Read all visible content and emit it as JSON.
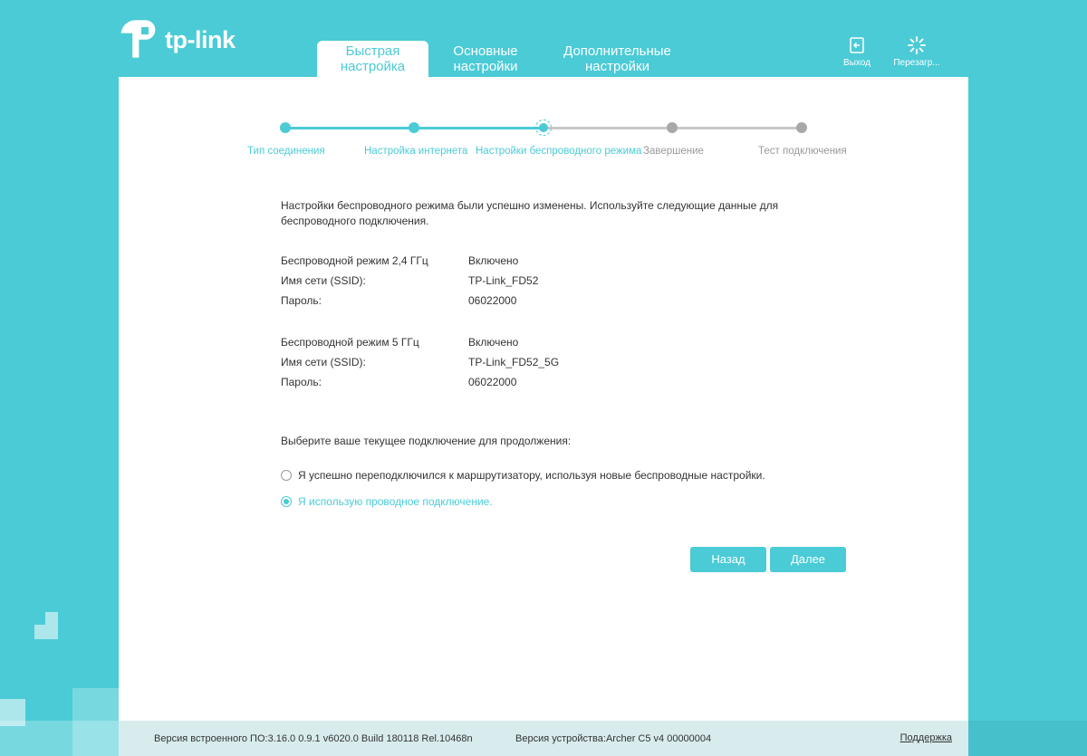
{
  "brand": {
    "name": "tp-link"
  },
  "tabs": [
    {
      "label": "Быстрая настройка",
      "active": true
    },
    {
      "label": "Основные настройки",
      "active": false
    },
    {
      "label": "Дополнительные настройки",
      "active": false
    }
  ],
  "actions": {
    "logout": "Выход",
    "reboot": "Перезагр..."
  },
  "steps": [
    {
      "label": "Тип соединения",
      "state": "done"
    },
    {
      "label": "Настройка интернета",
      "state": "done"
    },
    {
      "label": "Настройки беспроводного режима",
      "state": "current"
    },
    {
      "label": "Завершение",
      "state": "todo"
    },
    {
      "label": "Тест подключения",
      "state": "todo"
    }
  ],
  "content": {
    "intro": "Настройки беспроводного режима были успешно изменены. Используйте следующие данные для беспроводного подключения.",
    "band24": {
      "mode_label": "Беспроводной режим 2,4 ГГц",
      "mode_value": "Включено",
      "ssid_label": "Имя сети (SSID):",
      "ssid_value": "TP-Link_FD52",
      "pass_label": "Пароль:",
      "pass_value": "06022000"
    },
    "band5": {
      "mode_label": "Беспроводной режим 5 ГГц",
      "mode_value": "Включено",
      "ssid_label": "Имя сети (SSID):",
      "ssid_value": "TP-Link_FD52_5G",
      "pass_label": "Пароль:",
      "pass_value": "06022000"
    },
    "prompt": "Выберите ваше текущее подключение для продолжения:",
    "options": [
      {
        "label": "Я успешно переподключился к маршрутизатору, используя новые беспроводные настройки.",
        "checked": false
      },
      {
        "label": "Я использую проводное подключение.",
        "checked": true
      }
    ],
    "back": "Назад",
    "next": "Далее"
  },
  "footer": {
    "firmware": "Версия встроенного ПО:3.16.0 0.9.1 v6020.0 Build 180118 Rel.10468n",
    "hardware": "Версия устройства:Archer C5 v4 00000004",
    "support": "Поддержка"
  },
  "colors": {
    "accent": "#4acbd6",
    "inactive": "#a8a8a8"
  }
}
